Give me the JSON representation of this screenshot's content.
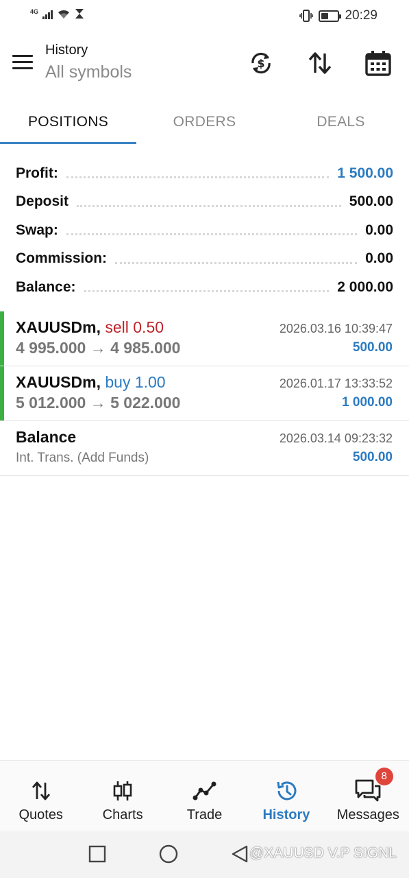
{
  "status_bar": {
    "network": "4G",
    "time": "20:29",
    "battery_level": 0.45
  },
  "header": {
    "title": "History",
    "subtitle": "All symbols",
    "icons": [
      "menu-icon",
      "currency-exchange-icon",
      "sort-icon",
      "calendar-icon"
    ]
  },
  "tabs": [
    {
      "label": "POSITIONS",
      "active": true
    },
    {
      "label": "ORDERS",
      "active": false
    },
    {
      "label": "DEALS",
      "active": false
    }
  ],
  "summary": [
    {
      "label": "Profit:",
      "value": "1 500.00",
      "highlight": true
    },
    {
      "label": "Deposit",
      "value": "500.00",
      "highlight": false
    },
    {
      "label": "Swap:",
      "value": "0.00",
      "highlight": false
    },
    {
      "label": "Commission:",
      "value": "0.00",
      "highlight": false
    },
    {
      "label": "Balance:",
      "value": "2 000.00",
      "highlight": false
    }
  ],
  "history": [
    {
      "symbol": "XAUUSDm",
      "separator": ",",
      "type": "sell 0.50",
      "prices": "4 995.000 → 4 985.000",
      "datetime": "2026.03.16 10:39:47",
      "profit": "500.00"
    },
    {
      "symbol": "XAUUSDm",
      "separator": ",",
      "type": "buy 1.00",
      "prices": "5 012.000 → 5 022.000",
      "datetime": "2026.01.17 13:33:52",
      "profit": "1 000.00"
    },
    {
      "symbol": "Balance",
      "separator": "",
      "type": "",
      "prices": "Int. Trans. (Add Funds)",
      "datetime": "2026.03.14 09:23:32",
      "profit": "500.00"
    }
  ],
  "bottom_nav": [
    {
      "label": "Quotes",
      "icon": "quotes-arrows-icon",
      "active": false
    },
    {
      "label": "Charts",
      "icon": "candlestick-icon",
      "active": false
    },
    {
      "label": "Trade",
      "icon": "trade-line-icon",
      "active": false
    },
    {
      "label": "History",
      "icon": "history-clock-icon",
      "active": true
    },
    {
      "label": "Messages",
      "icon": "messages-icon",
      "active": false,
      "badge": "8"
    }
  ],
  "watermark": "@XAUUSD V.P SIGNL",
  "colors": {
    "accent_blue": "#2b7bc1",
    "sell_red": "#c0242b",
    "position_green": "#3cb043",
    "tab_underline": "#3c84c4"
  }
}
